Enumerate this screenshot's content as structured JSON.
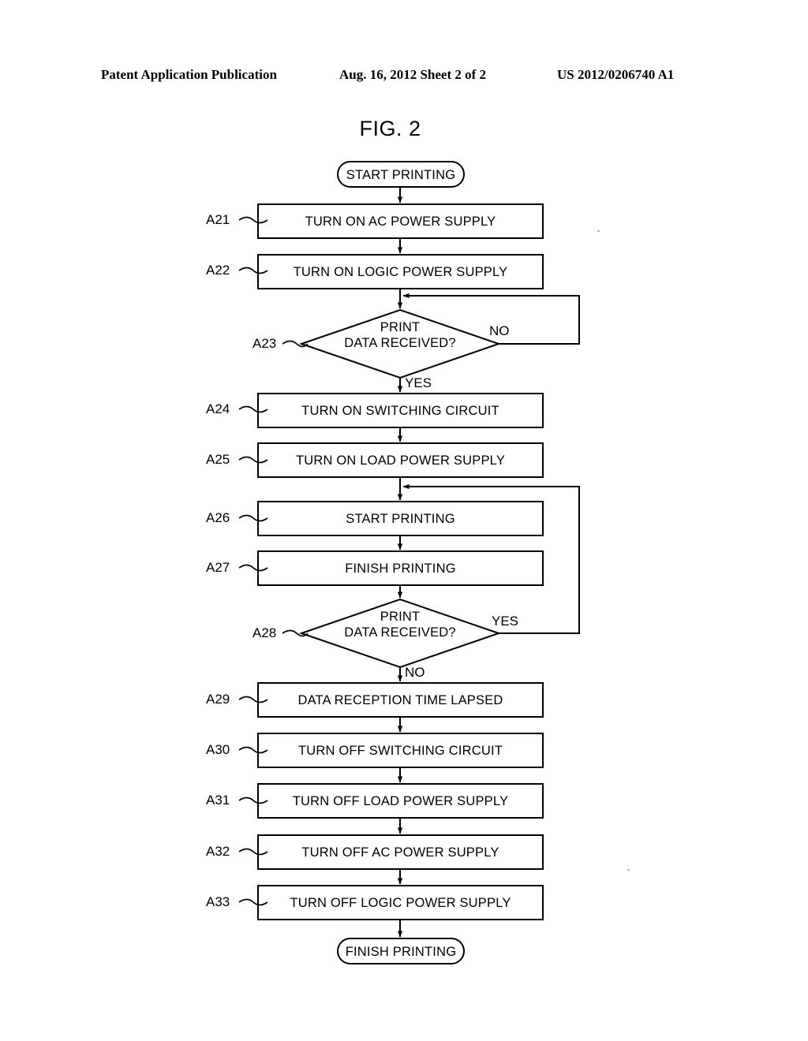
{
  "header": {
    "left": "Patent Application Publication",
    "middle": "Aug. 16, 2012  Sheet 2 of 2",
    "right": "US 2012/0206740 A1"
  },
  "figure": {
    "title": "FIG. 2"
  },
  "flowchart": {
    "start_terminal": "START PRINTING",
    "end_terminal": "FINISH PRINTING",
    "steps": [
      {
        "id": "A21",
        "text": "TURN ON AC POWER SUPPLY",
        "shape": "process"
      },
      {
        "id": "A22",
        "text": "TURN ON LOGIC POWER SUPPLY",
        "shape": "process"
      },
      {
        "id": "A23",
        "text_line1": "PRINT",
        "text_line2": "DATA RECEIVED?",
        "shape": "decision"
      },
      {
        "id": "A24",
        "text": "TURN ON SWITCHING CIRCUIT",
        "shape": "process"
      },
      {
        "id": "A25",
        "text": "TURN ON LOAD POWER SUPPLY",
        "shape": "process"
      },
      {
        "id": "A26",
        "text": "START PRINTING",
        "shape": "process"
      },
      {
        "id": "A27",
        "text": "FINISH PRINTING",
        "shape": "process"
      },
      {
        "id": "A28",
        "text_line1": "PRINT",
        "text_line2": "DATA RECEIVED?",
        "shape": "decision"
      },
      {
        "id": "A29",
        "text": "DATA RECEPTION TIME LAPSED",
        "shape": "process"
      },
      {
        "id": "A30",
        "text": "TURN OFF SWITCHING CIRCUIT",
        "shape": "process"
      },
      {
        "id": "A31",
        "text": "TURN OFF LOAD POWER SUPPLY",
        "shape": "process"
      },
      {
        "id": "A32",
        "text": "TURN OFF AC POWER SUPPLY",
        "shape": "process"
      },
      {
        "id": "A33",
        "text": "TURN OFF LOGIC POWER SUPPLY",
        "shape": "process"
      }
    ],
    "branches": {
      "a23_no": "NO",
      "a23_yes": "YES",
      "a28_yes": "YES",
      "a28_no": "NO"
    },
    "colors": {
      "stroke": "#000000",
      "fill": "#ffffff",
      "background": "#ffffff"
    }
  }
}
